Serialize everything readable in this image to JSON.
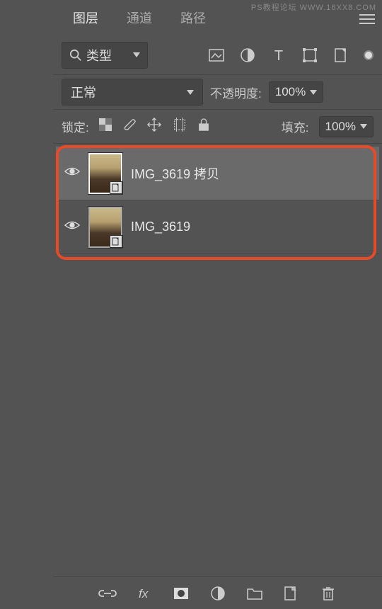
{
  "watermark": "PS教程论坛 WWW.16XX8.COM",
  "tabs": {
    "layers": "图层",
    "channels": "通道",
    "paths": "路径"
  },
  "filter": {
    "type_label": "类型"
  },
  "blend": {
    "mode": "正常",
    "opacity_label": "不透明度:",
    "opacity_value": "100%"
  },
  "lock": {
    "label": "锁定:",
    "fill_label": "填充:",
    "fill_value": "100%"
  },
  "layers": [
    {
      "name": "IMG_3619 拷贝",
      "selected": true
    },
    {
      "name": "IMG_3619",
      "selected": false
    }
  ]
}
